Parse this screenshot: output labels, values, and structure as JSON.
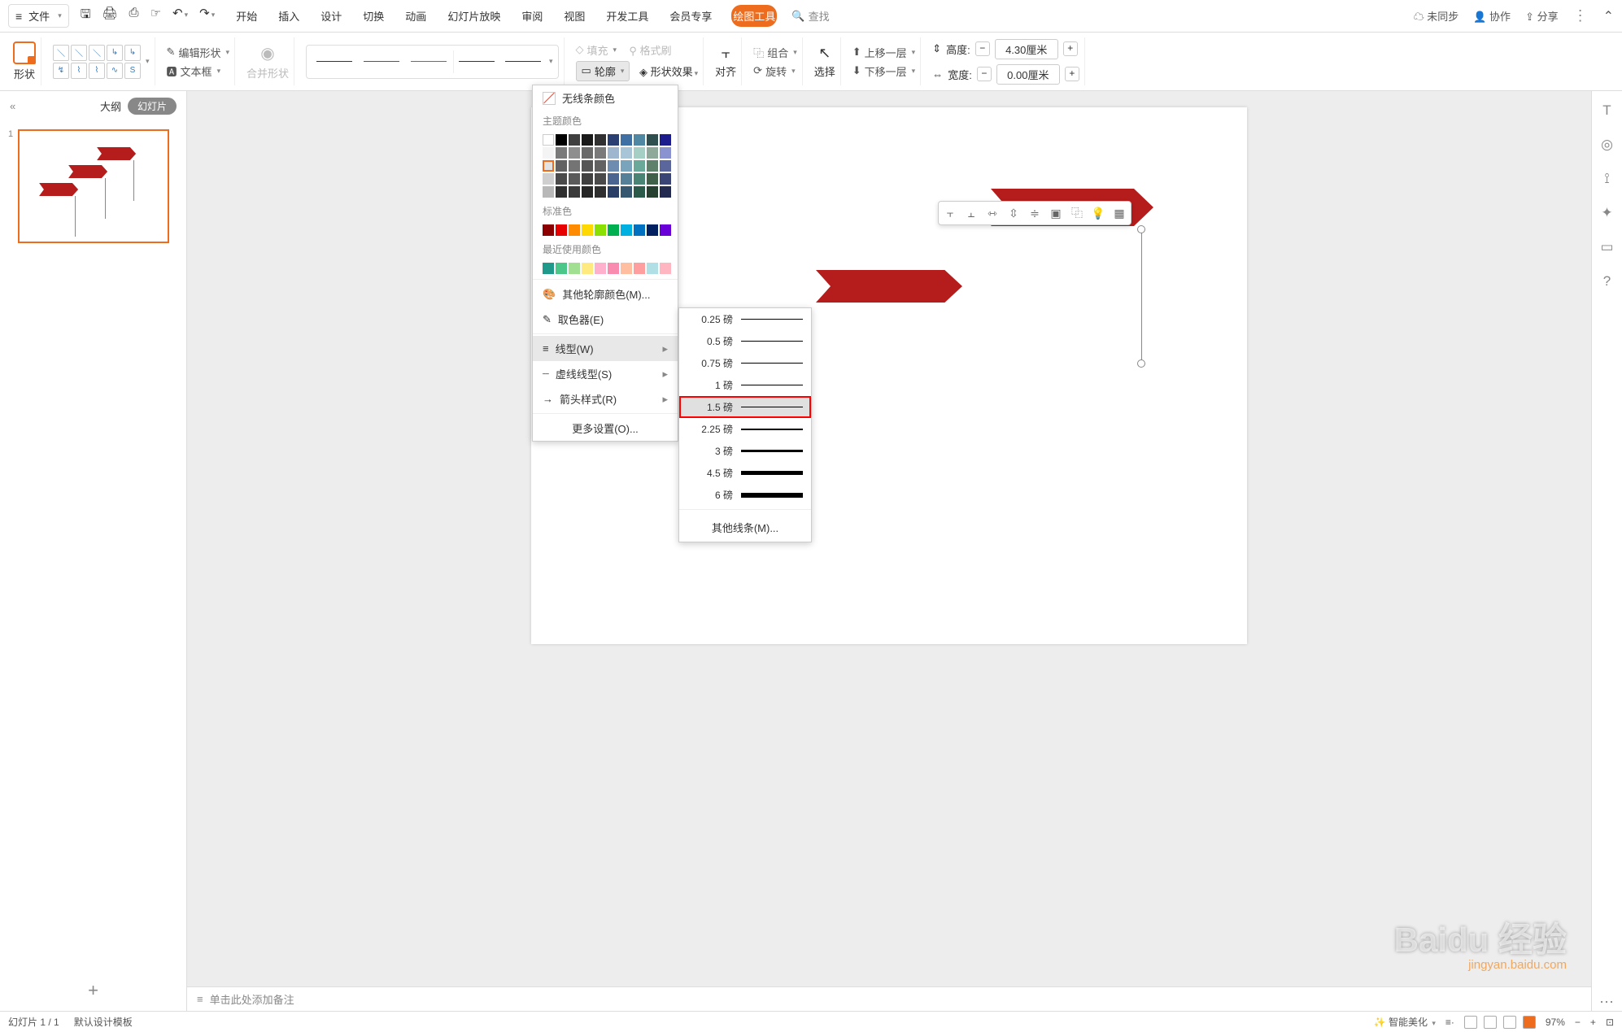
{
  "topbar": {
    "file": "文件",
    "tabs": [
      "开始",
      "插入",
      "设计",
      "切换",
      "动画",
      "幻灯片放映",
      "审阅",
      "视图",
      "开发工具",
      "会员专享"
    ],
    "drawing_tool": "绘图工具",
    "search": "查找",
    "unsynced": "未同步",
    "coop": "协作",
    "share": "分享"
  },
  "ribbon": {
    "shape": "形状",
    "edit_shape": "编辑形状",
    "text_box": "文本框",
    "merge_shape": "合并形状",
    "fill": "填充",
    "format_painter": "格式刷",
    "outline": "轮廓",
    "shape_effect": "形状效果",
    "align": "对齐",
    "group": "组合",
    "rotate": "旋转",
    "select": "选择",
    "move_up": "上移一层",
    "move_down": "下移一层",
    "height": "高度:",
    "width": "宽度:",
    "height_val": "4.30厘米",
    "width_val": "0.00厘米"
  },
  "left": {
    "outline_tab": "大纲",
    "slides_tab": "幻灯片",
    "slide_num": "1"
  },
  "popup": {
    "no_line": "无线条颜色",
    "theme_colors": "主题颜色",
    "standard_colors": "标准色",
    "recent_colors": "最近使用颜色",
    "more_colors": "其他轮廓颜色(M)...",
    "eyedropper": "取色器(E)",
    "weight": "线型(W)",
    "dash": "虚线线型(S)",
    "arrows": "箭头样式(R)",
    "more_settings": "更多设置(O)..."
  },
  "weights": {
    "w025": "0.25 磅",
    "w05": "0.5 磅",
    "w075": "0.75 磅",
    "w1": "1 磅",
    "w15": "1.5 磅",
    "w225": "2.25 磅",
    "w3": "3 磅",
    "w45": "4.5 磅",
    "w6": "6 磅",
    "more": "其他线条(M)..."
  },
  "notes": "单击此处添加备注",
  "status": {
    "page": "幻灯片 1 / 1",
    "template": "默认设计模板",
    "beautify": "智能美化",
    "zoom": "97%"
  },
  "watermark": "Baidu 经验",
  "watermark_sub": "jingyan.baidu.com"
}
